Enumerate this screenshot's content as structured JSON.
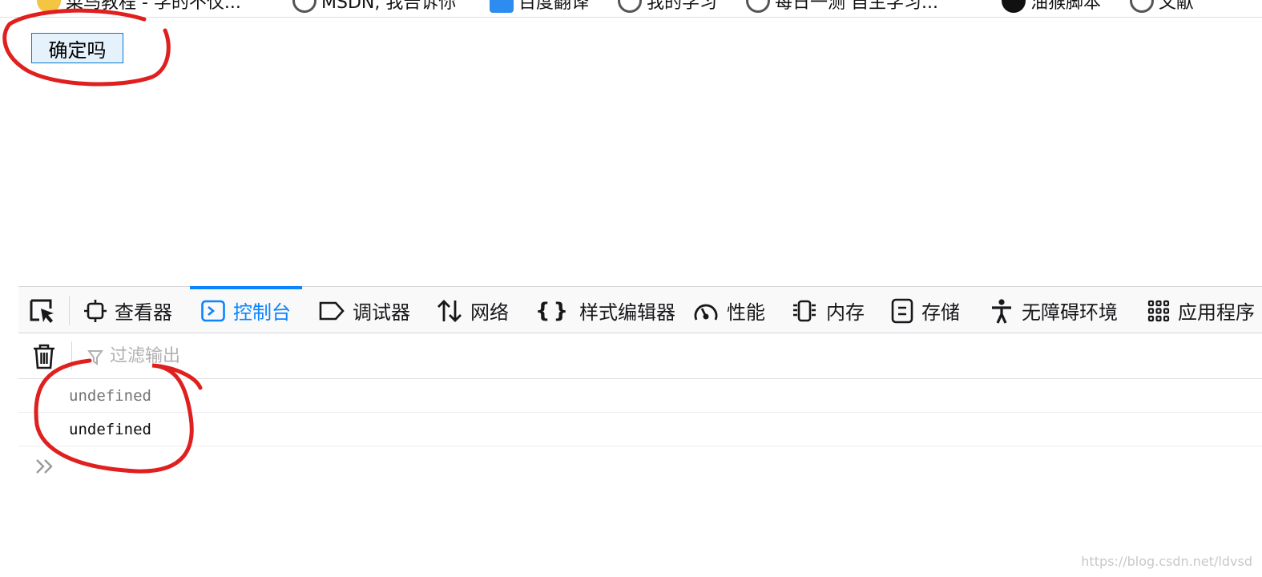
{
  "bookmarks": [
    {
      "label": "菜鸟教程 - 学的不仅...",
      "icon": "runoob-icon"
    },
    {
      "label": "MSDN, 我告诉你",
      "icon": "globe-icon"
    },
    {
      "label": "百度翻译",
      "icon": "baidu-translate-icon"
    },
    {
      "label": "我的学习",
      "icon": "globe-icon"
    },
    {
      "label": "每日一测 自主学习...",
      "icon": "globe-icon"
    },
    {
      "label": "油猴脚本",
      "icon": "tampermonkey-icon"
    },
    {
      "label": "文献",
      "icon": "globe-icon"
    }
  ],
  "page": {
    "confirm_button_label": "确定吗"
  },
  "devtools": {
    "tabs": [
      {
        "label": "查看器",
        "icon": "inspector-icon"
      },
      {
        "label": "控制台",
        "icon": "console-icon",
        "selected": true
      },
      {
        "label": "调试器",
        "icon": "debugger-icon"
      },
      {
        "label": "网络",
        "icon": "network-icon"
      },
      {
        "label": "样式编辑器",
        "icon": "style-editor-icon"
      },
      {
        "label": "性能",
        "icon": "performance-icon"
      },
      {
        "label": "内存",
        "icon": "memory-icon"
      },
      {
        "label": "存储",
        "icon": "storage-icon"
      },
      {
        "label": "无障碍环境",
        "icon": "accessibility-icon"
      },
      {
        "label": "应用程序",
        "icon": "application-icon"
      }
    ],
    "filter_placeholder": "过滤输出",
    "console_messages": [
      {
        "text": "undefined",
        "kind": "result"
      },
      {
        "text": "undefined",
        "kind": "output"
      }
    ],
    "accent_color": "#0a84ff"
  },
  "annotation_color": "#e0201f",
  "watermark": "https://blog.csdn.net/ldvsd"
}
